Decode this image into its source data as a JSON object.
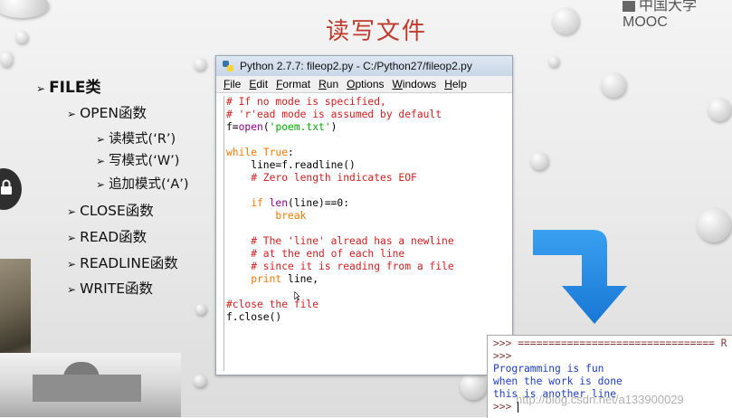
{
  "slide": {
    "title": "读写文件",
    "watermark_top": "中国大学MOOC",
    "watermark_bottom": "http://blog.csdn.net/a133900029"
  },
  "outline": {
    "l1": {
      "bullet": "➢",
      "label": "FILE类"
    },
    "items": [
      {
        "bullet": "➢",
        "label": "OPEN函数"
      },
      {
        "bullet": "➢",
        "label": "读模式(‘R’)"
      },
      {
        "bullet": "➢",
        "label": "写模式(‘W’)"
      },
      {
        "bullet": "➢",
        "label": "追加模式(‘A’)"
      },
      {
        "bullet": "➢",
        "label": "CLOSE函数"
      },
      {
        "bullet": "➢",
        "label": "READ函数"
      },
      {
        "bullet": "➢",
        "label": "READLINE函数"
      },
      {
        "bullet": "➢",
        "label": "WRITE函数"
      }
    ]
  },
  "editor": {
    "window_title": "Python 2.7.7: fileop2.py - C:/Python27/fileop2.py",
    "menu": [
      {
        "underline": "F",
        "rest": "ile"
      },
      {
        "underline": "E",
        "rest": "dit"
      },
      {
        "underline": "F",
        "rest": "ormat"
      },
      {
        "underline": "R",
        "rest": "un"
      },
      {
        "underline": "O",
        "rest": "ptions"
      },
      {
        "underline": "W",
        "rest": "indows"
      },
      {
        "underline": "H",
        "rest": "elp"
      }
    ],
    "code": {
      "l1": "# If no mode is specified,",
      "l2": "# 'r'ead mode is assumed by default",
      "l3_a": "f=",
      "l3_b": "open",
      "l3_c": "(",
      "l3_d": "'poem.txt'",
      "l3_e": ")",
      "l4_a": "while",
      "l4_b": " ",
      "l4_c": "True",
      "l4_d": ":",
      "l5": "    line=f.readline()",
      "l6": "    # Zero length indicates EOF",
      "l7_a": "    if ",
      "l7_b": "len",
      "l7_c": "(line)==0:",
      "l8": "        break",
      "l9": "    # The 'line' alread has a newline",
      "l10": "    # at the end of each line",
      "l11": "    # since it is reading from a file",
      "l12_a": "    print",
      "l12_b": " line,",
      "l13": "#close the file",
      "l14": "f.close()"
    }
  },
  "shell": {
    "prompt": ">>>",
    "restart_line": " ================================ R",
    "output": [
      "Programming is fun",
      "when the work is done",
      "this is another line"
    ]
  },
  "colors": {
    "title_red": "#c0392b",
    "arrow_blue": "#1e90e6",
    "comment": "#d42020",
    "keyword": "#ff7700",
    "string": "#00aa00",
    "builtin": "#900090",
    "shell_output": "#1d3fc8"
  }
}
